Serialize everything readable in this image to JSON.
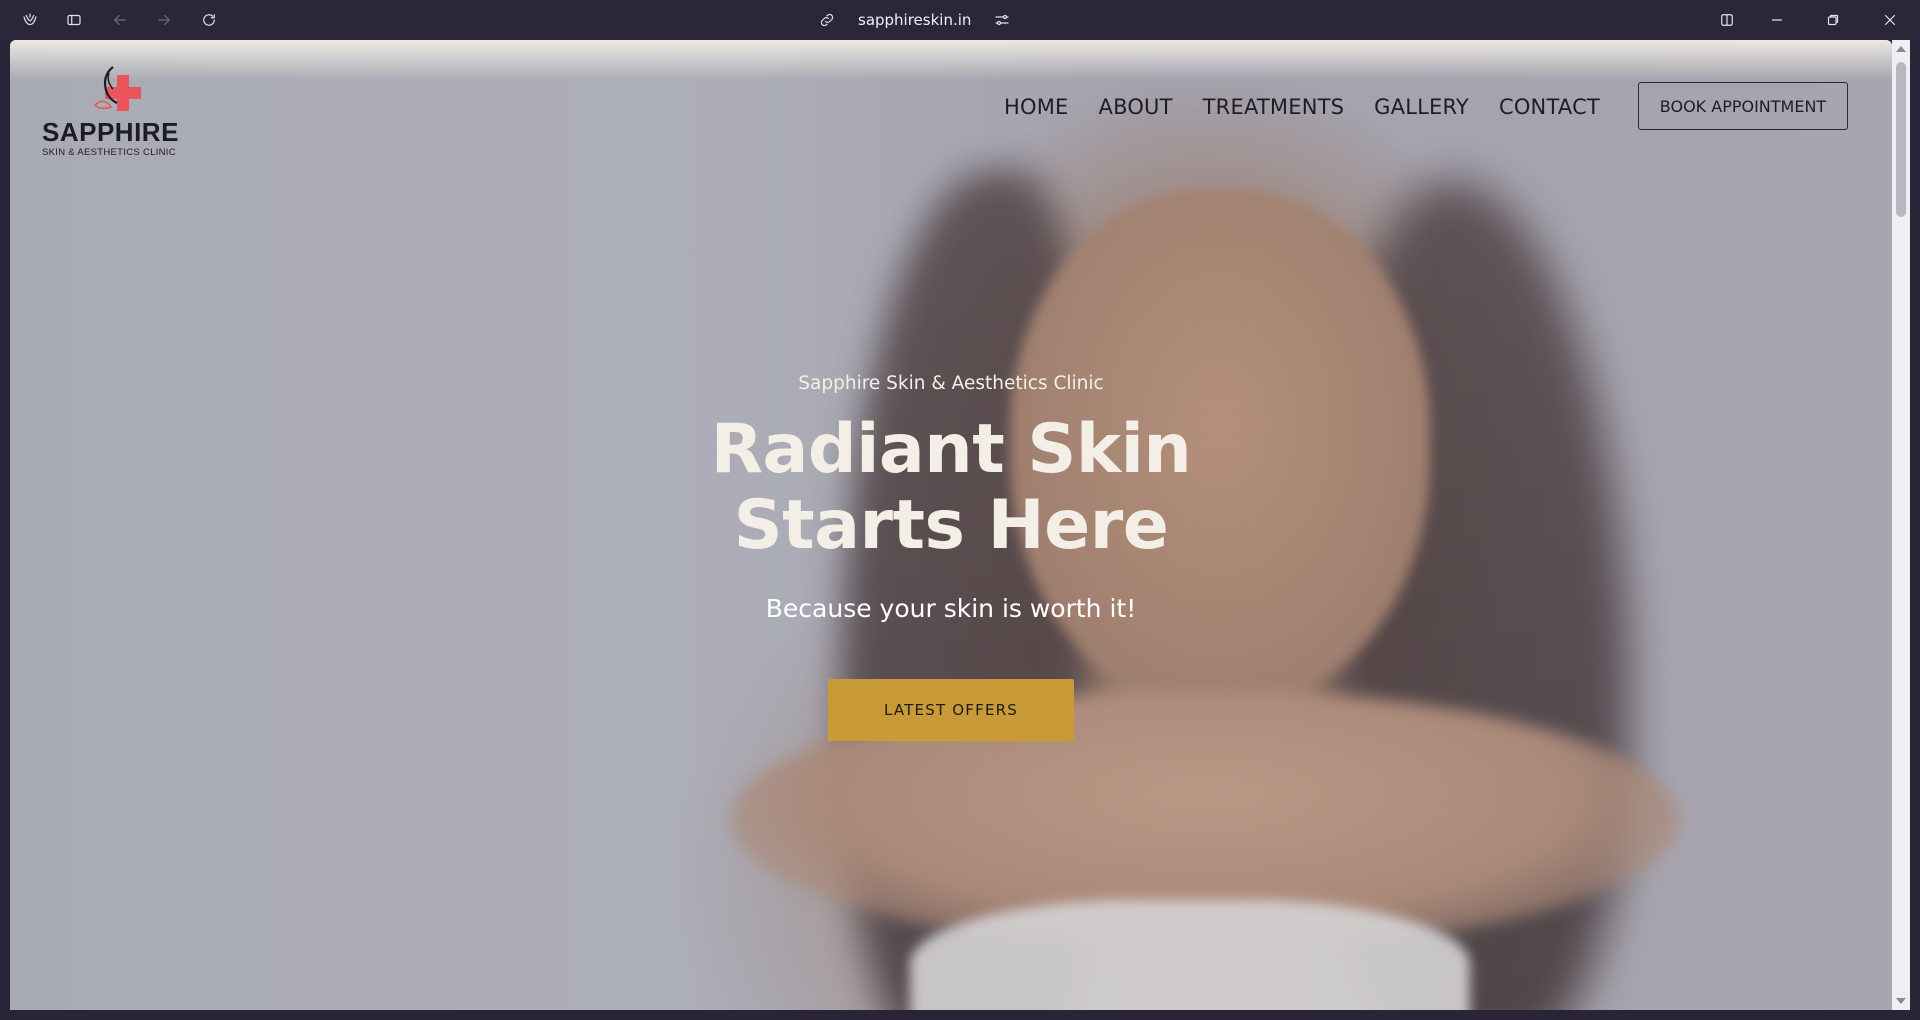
{
  "browser": {
    "url": "sapphireskin.in",
    "icons": [
      "app-logo-icon",
      "sidebar-toggle-icon",
      "back-arrow-icon",
      "forward-arrow-icon",
      "reload-icon",
      "link-icon",
      "site-settings-icon",
      "split-view-icon",
      "minimize-icon",
      "restore-icon",
      "close-icon"
    ]
  },
  "site": {
    "logo_name": "SAPPHIRE",
    "logo_subtitle": "SKIN & AESTHETICS CLINIC",
    "nav": {
      "home": "HOME",
      "about": "ABOUT",
      "treatments": "TREATMENTS",
      "gallery": "GALLERY",
      "contact": "CONTACT"
    },
    "book_button": "BOOK APPOINTMENT"
  },
  "hero": {
    "kicker": "Sapphire Skin & Aesthetics Clinic",
    "title_line1": "Radiant Skin",
    "title_line2": "Starts Here",
    "subtitle": "Because your skin is worth it!",
    "cta": "LATEST OFFERS"
  },
  "colors": {
    "chrome_bg": "#2b2639",
    "cta_gold": "#c89a38",
    "logo_red": "#e9555a",
    "text_dark": "#1e1c2a"
  }
}
